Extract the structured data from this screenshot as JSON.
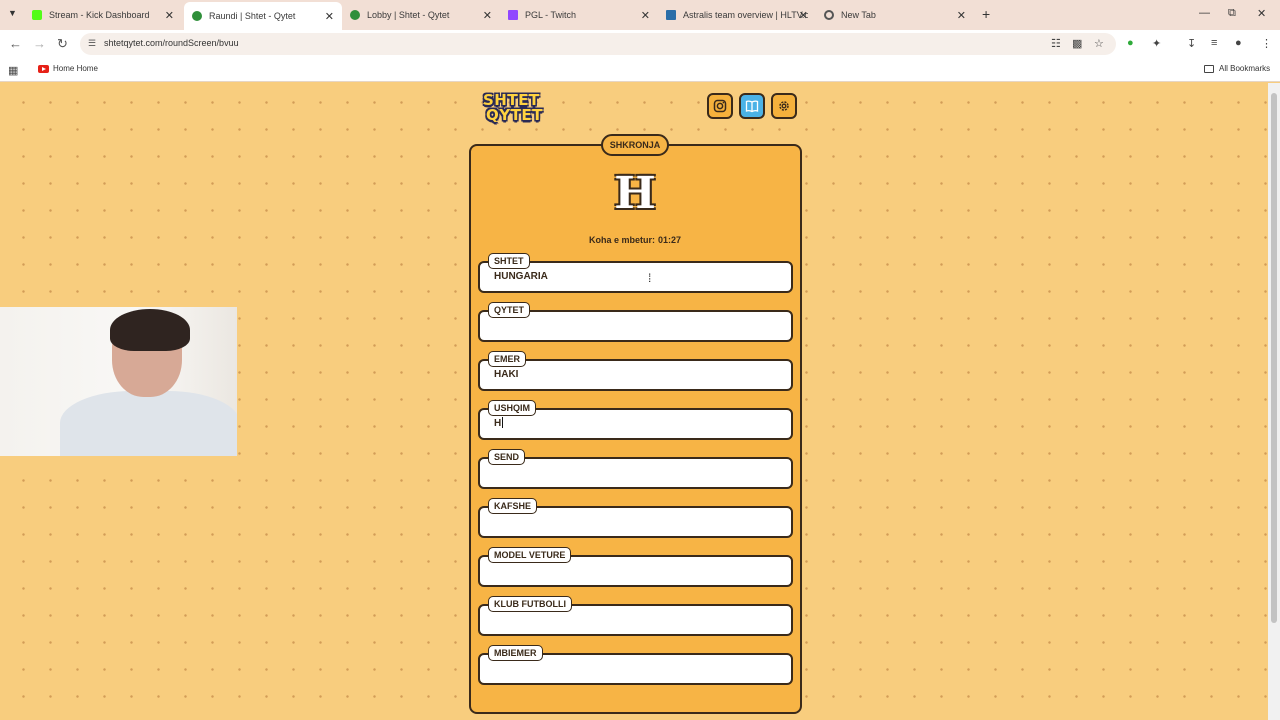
{
  "browser": {
    "tabs": [
      {
        "label": "Stream - Kick Dashboard",
        "favicon": "kick-icon",
        "color": "#53fc18",
        "active": false
      },
      {
        "label": "Raundi | Shtet - Qytet",
        "favicon": "shtet-qytet-icon",
        "color": "#2f8f3a",
        "active": true
      },
      {
        "label": "Lobby | Shtet - Qytet",
        "favicon": "shtet-qytet-icon",
        "color": "#2f8f3a",
        "active": false
      },
      {
        "label": "PGL - Twitch",
        "favicon": "twitch-icon",
        "color": "#9146ff",
        "active": false
      },
      {
        "label": "Astralis team overview | HLTV.o",
        "favicon": "hltv-icon",
        "color": "#2b6ea8",
        "active": false
      },
      {
        "label": "New Tab",
        "favicon": "chrome-icon",
        "color": "#555555",
        "active": false
      }
    ],
    "url": "shtetqytet.com/roundScreen/bvuu",
    "bookmarks": {
      "home": "Home Home",
      "all": "All Bookmarks"
    }
  },
  "game": {
    "logo_line1": "SHTET",
    "logo_line2": "QYTET",
    "round_label": "SHKRONJA",
    "letter": "H",
    "timer_label": "Koha e mbetur:",
    "timer_value": "01:27",
    "fields": [
      {
        "label": "SHTET",
        "value": "HUNGARIA"
      },
      {
        "label": "QYTET",
        "value": ""
      },
      {
        "label": "EMER",
        "value": "HAKI"
      },
      {
        "label": "USHQIM",
        "value": "H"
      },
      {
        "label": "SEND",
        "value": ""
      },
      {
        "label": "KAFSHE",
        "value": ""
      },
      {
        "label": "MODEL VETURE",
        "value": ""
      },
      {
        "label": "KLUB FUTBOLLI",
        "value": ""
      },
      {
        "label": "MBIEMER",
        "value": ""
      }
    ]
  },
  "colors": {
    "page_bg": "#f8cd7e",
    "card_bg": "#f7b445",
    "outline": "#3a2a1a",
    "book_button": "#4bb2e6"
  }
}
